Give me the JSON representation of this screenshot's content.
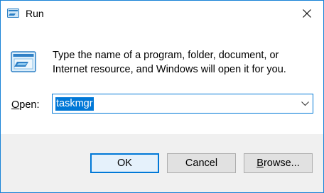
{
  "window": {
    "title": "Run",
    "accent_color": "#0078d7"
  },
  "icons": {
    "title": "run-icon",
    "main": "run-icon",
    "close": "close-icon",
    "dropdown": "chevron-down-icon"
  },
  "body": {
    "description": "Type the name of a program, folder, document, or Internet resource, and Windows will open it for you.",
    "open_label_key": "O",
    "open_label_rest": "pen:",
    "command_value": "taskmgr"
  },
  "buttons": {
    "ok_label": "OK",
    "cancel_label": "Cancel",
    "browse_label_key": "B",
    "browse_label_rest": "rowse..."
  }
}
